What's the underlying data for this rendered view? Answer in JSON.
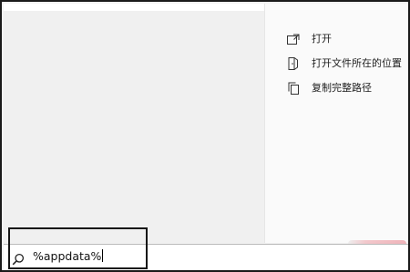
{
  "context_menu": {
    "items": [
      {
        "label": "打开",
        "icon": "open-icon"
      },
      {
        "label": "打开文件所在的位置",
        "icon": "file-location-icon"
      },
      {
        "label": "复制完整路径",
        "icon": "copy-icon"
      }
    ]
  },
  "search": {
    "value": "%appdata%",
    "icon": "search-icon"
  },
  "colors": {
    "highlight_border": "#151515",
    "accent_pink": "#f0b4ba"
  }
}
